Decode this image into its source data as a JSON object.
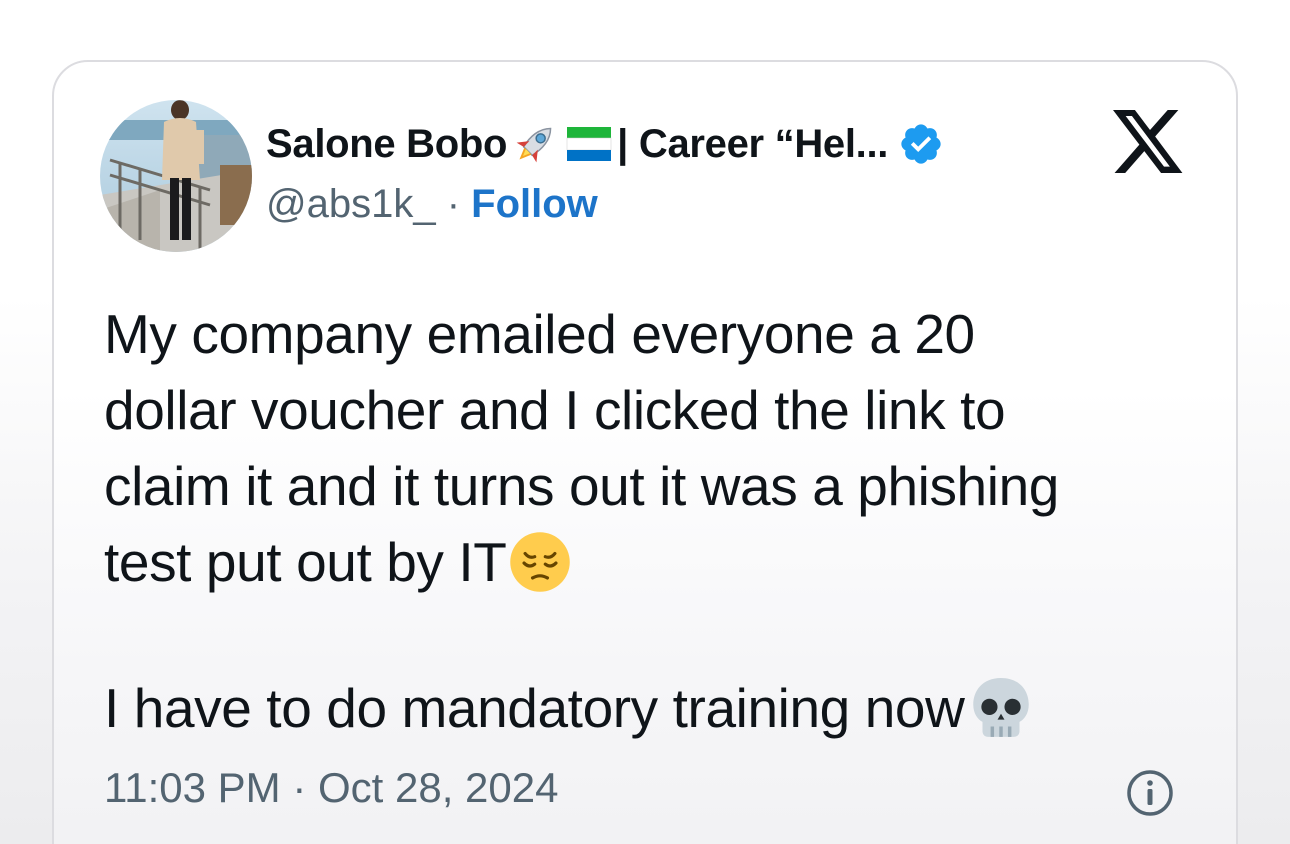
{
  "tweet": {
    "author": {
      "name_part1": "Salone Bobo",
      "name_part2": "| Career “Hel...",
      "emojis": [
        "rocket-emoji",
        "sierra-leone-flag-emoji"
      ],
      "handle": "@abs1k_",
      "separator": " · ",
      "follow_label": "Follow",
      "verified": true
    },
    "body": {
      "line1": "My company emailed everyone a 20",
      "line2": "dollar voucher and I clicked the link to",
      "line3": "claim it and it turns out it was a phishing",
      "line4": "test put out by IT",
      "line4_emoji": "pensive-face-emoji",
      "line5": "I have to do mandatory training now ",
      "line5_emoji": "skull-emoji"
    },
    "timestamp": "11:03 PM · Oct 28, 2024",
    "platform_logo": "x-logo",
    "info_icon": "info-icon"
  },
  "colors": {
    "follow": "#1d74c9",
    "verified_badge": "#1d9bf0",
    "text_primary": "#0f1419",
    "text_secondary": "#536471"
  }
}
